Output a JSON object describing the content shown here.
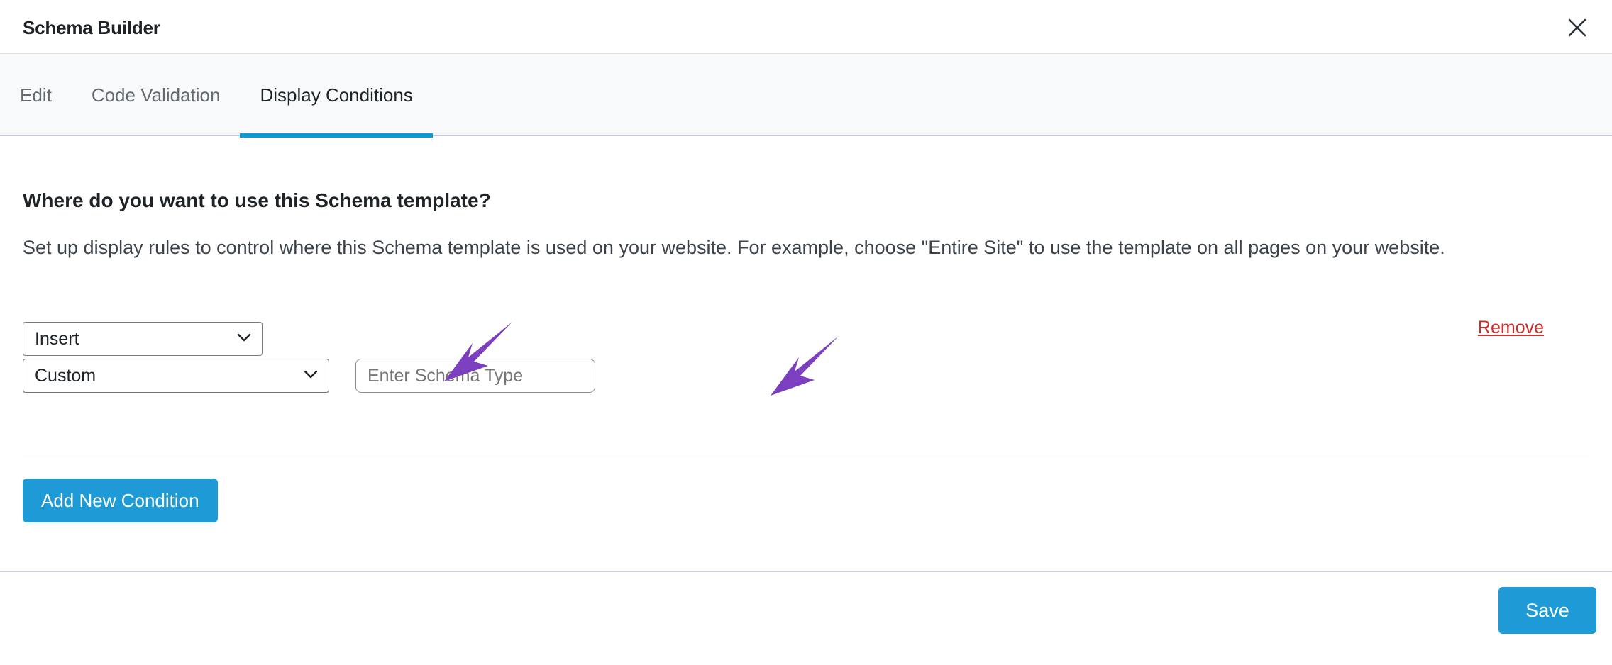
{
  "header": {
    "title": "Schema Builder",
    "close_icon": "close-icon"
  },
  "tabs": [
    {
      "label": "Edit",
      "active": false
    },
    {
      "label": "Code Validation",
      "active": false
    },
    {
      "label": "Display Conditions",
      "active": true
    }
  ],
  "content": {
    "heading": "Where do you want to use this Schema template?",
    "description": "Set up display rules to control where this Schema template is used on your website. For example, choose \"Entire Site\" to use the template on all pages on your website.",
    "condition": {
      "action_value": "Insert",
      "action_options": [
        "Insert"
      ],
      "target_value": "Custom",
      "target_options": [
        "Custom"
      ],
      "schema_type_value": "",
      "schema_type_placeholder": "Enter Schema Type",
      "remove_label": "Remove",
      "chevron_icon": "chevron-down-icon"
    },
    "add_condition_label": "Add New Condition"
  },
  "footer": {
    "save_label": "Save"
  },
  "annotations": [
    {
      "name": "arrow-pointing-to-custom-dropdown",
      "color": "#7b3fbf"
    },
    {
      "name": "arrow-pointing-to-schema-type-input",
      "color": "#7b3fbf"
    }
  ],
  "colors": {
    "accent_blue": "#1e9bd7",
    "tab_underline": "#0e9bd4",
    "remove_red": "#c9302c",
    "annotation_purple": "#7b3fbf",
    "tabbar_bg": "#f7f9fa"
  }
}
